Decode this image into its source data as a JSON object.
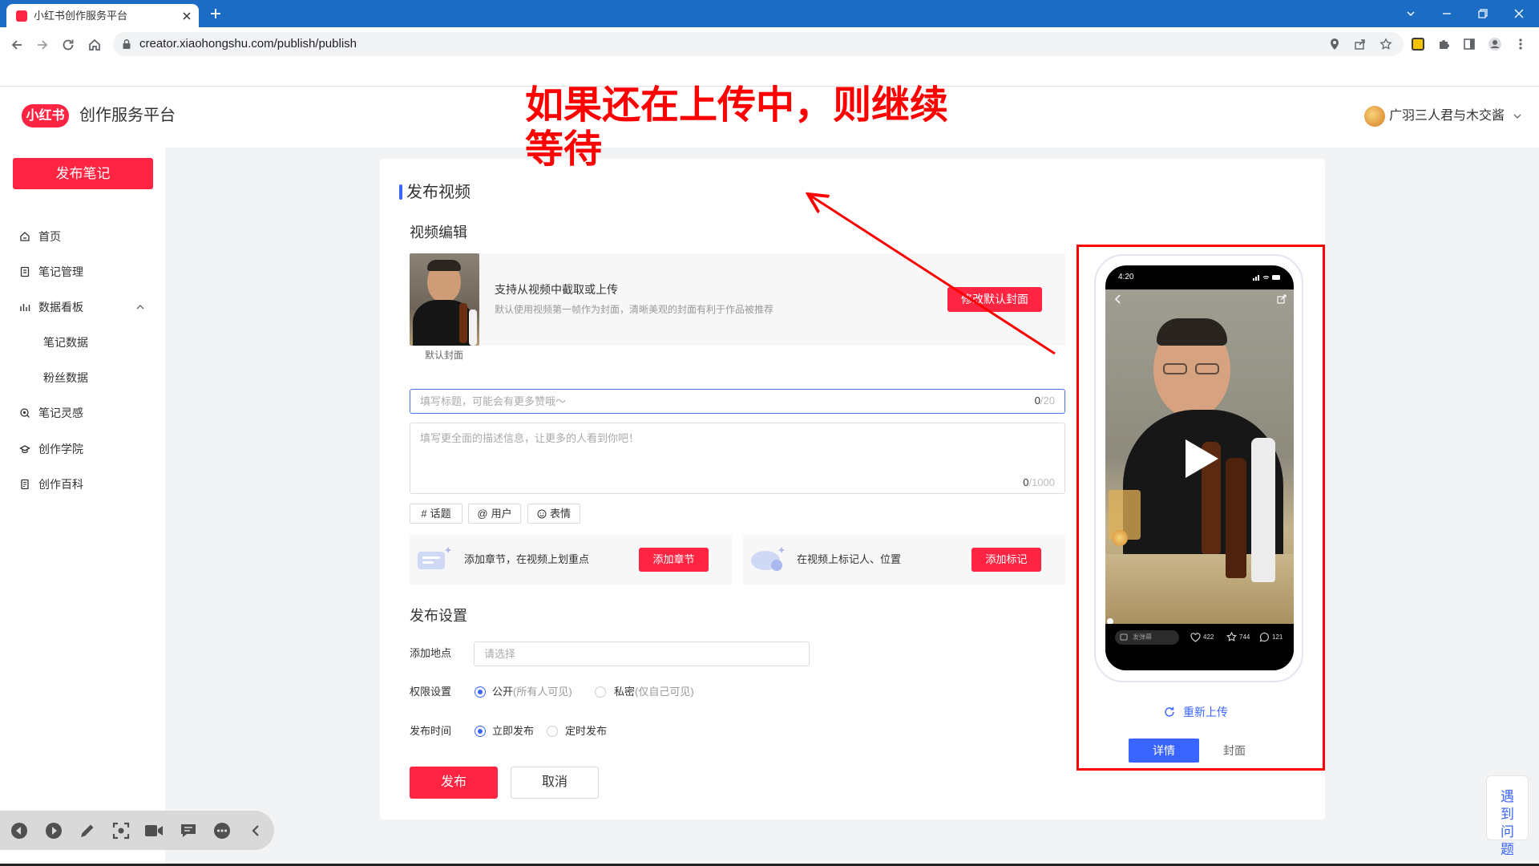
{
  "browser": {
    "tab_title": "小红书创作服务平台",
    "url": "creator.xiaohongshu.com/publish/publish",
    "theme_color": "#1c6cc4"
  },
  "header": {
    "logo_text": "小红书",
    "platform_title": "创作服务平台",
    "username": "广羽三人君与木交酱"
  },
  "annotation": {
    "line1": "如果还在上传中，则继续",
    "line2": "等待",
    "color": "#ff0000"
  },
  "sidebar": {
    "publish_button": "发布笔记",
    "items": [
      {
        "label": "首页",
        "icon": "home-icon"
      },
      {
        "label": "笔记管理",
        "icon": "note-icon"
      },
      {
        "label": "数据看板",
        "icon": "bar-chart-icon",
        "expanded": true
      },
      {
        "label": "笔记数据"
      },
      {
        "label": "粉丝数据"
      },
      {
        "label": "笔记灵感",
        "icon": "inspiration-icon"
      },
      {
        "label": "创作学院",
        "icon": "academy-icon"
      },
      {
        "label": "创作百科",
        "icon": "book-icon"
      }
    ]
  },
  "publish": {
    "heading": "发布视频",
    "video_edit_title": "视频编辑",
    "cover": {
      "caption": "默认封面",
      "title": "支持从视频中截取或上传",
      "hint": "默认使用视频第一帧作为封面，清晰美观的封面有利于作品被推荐",
      "button": "修改默认封面"
    },
    "title_input": {
      "placeholder": "填写标题，可能会有更多赞哦～",
      "count": "0",
      "max": "/20"
    },
    "description": {
      "placeholder": "填写更全面的描述信息，让更多的人看到你吧！",
      "count": "0",
      "max": "/1000"
    },
    "tags": [
      {
        "symbol": "#",
        "label": "话题"
      },
      {
        "symbol": "@",
        "label": "用户"
      },
      {
        "label": "表情",
        "icon": "smiley-icon"
      }
    ],
    "chapter": {
      "text": "添加章节，在视频上划重点",
      "button": "添加章节"
    },
    "mark": {
      "text": "在视频上标记人、位置",
      "button": "添加标记"
    },
    "settings_title": "发布设置",
    "location": {
      "label": "添加地点",
      "placeholder": "请选择"
    },
    "permission": {
      "label": "权限设置",
      "options": [
        {
          "label": "公开",
          "note": "(所有人可见)",
          "checked": true
        },
        {
          "label": "私密",
          "note": "(仅自己可见)",
          "checked": false
        }
      ]
    },
    "schedule": {
      "label": "发布时间",
      "options": [
        {
          "label": "立即发布",
          "checked": true
        },
        {
          "label": "定时发布",
          "checked": false
        }
      ]
    },
    "submit_button": "发布",
    "cancel_button": "取消"
  },
  "preview": {
    "status_time": "4:20",
    "danmaku": "发弹幕",
    "likes": "422",
    "collects": "744",
    "comments": "121",
    "reupload": "重新上传",
    "tabs": [
      {
        "label": "详情",
        "active": true
      },
      {
        "label": "封面",
        "active": false
      }
    ]
  },
  "help": {
    "label": "遇到问题"
  },
  "colors": {
    "brand_red": "#ff2442",
    "accent_blue": "#3a64ff",
    "annotation_red": "#ff0000"
  }
}
